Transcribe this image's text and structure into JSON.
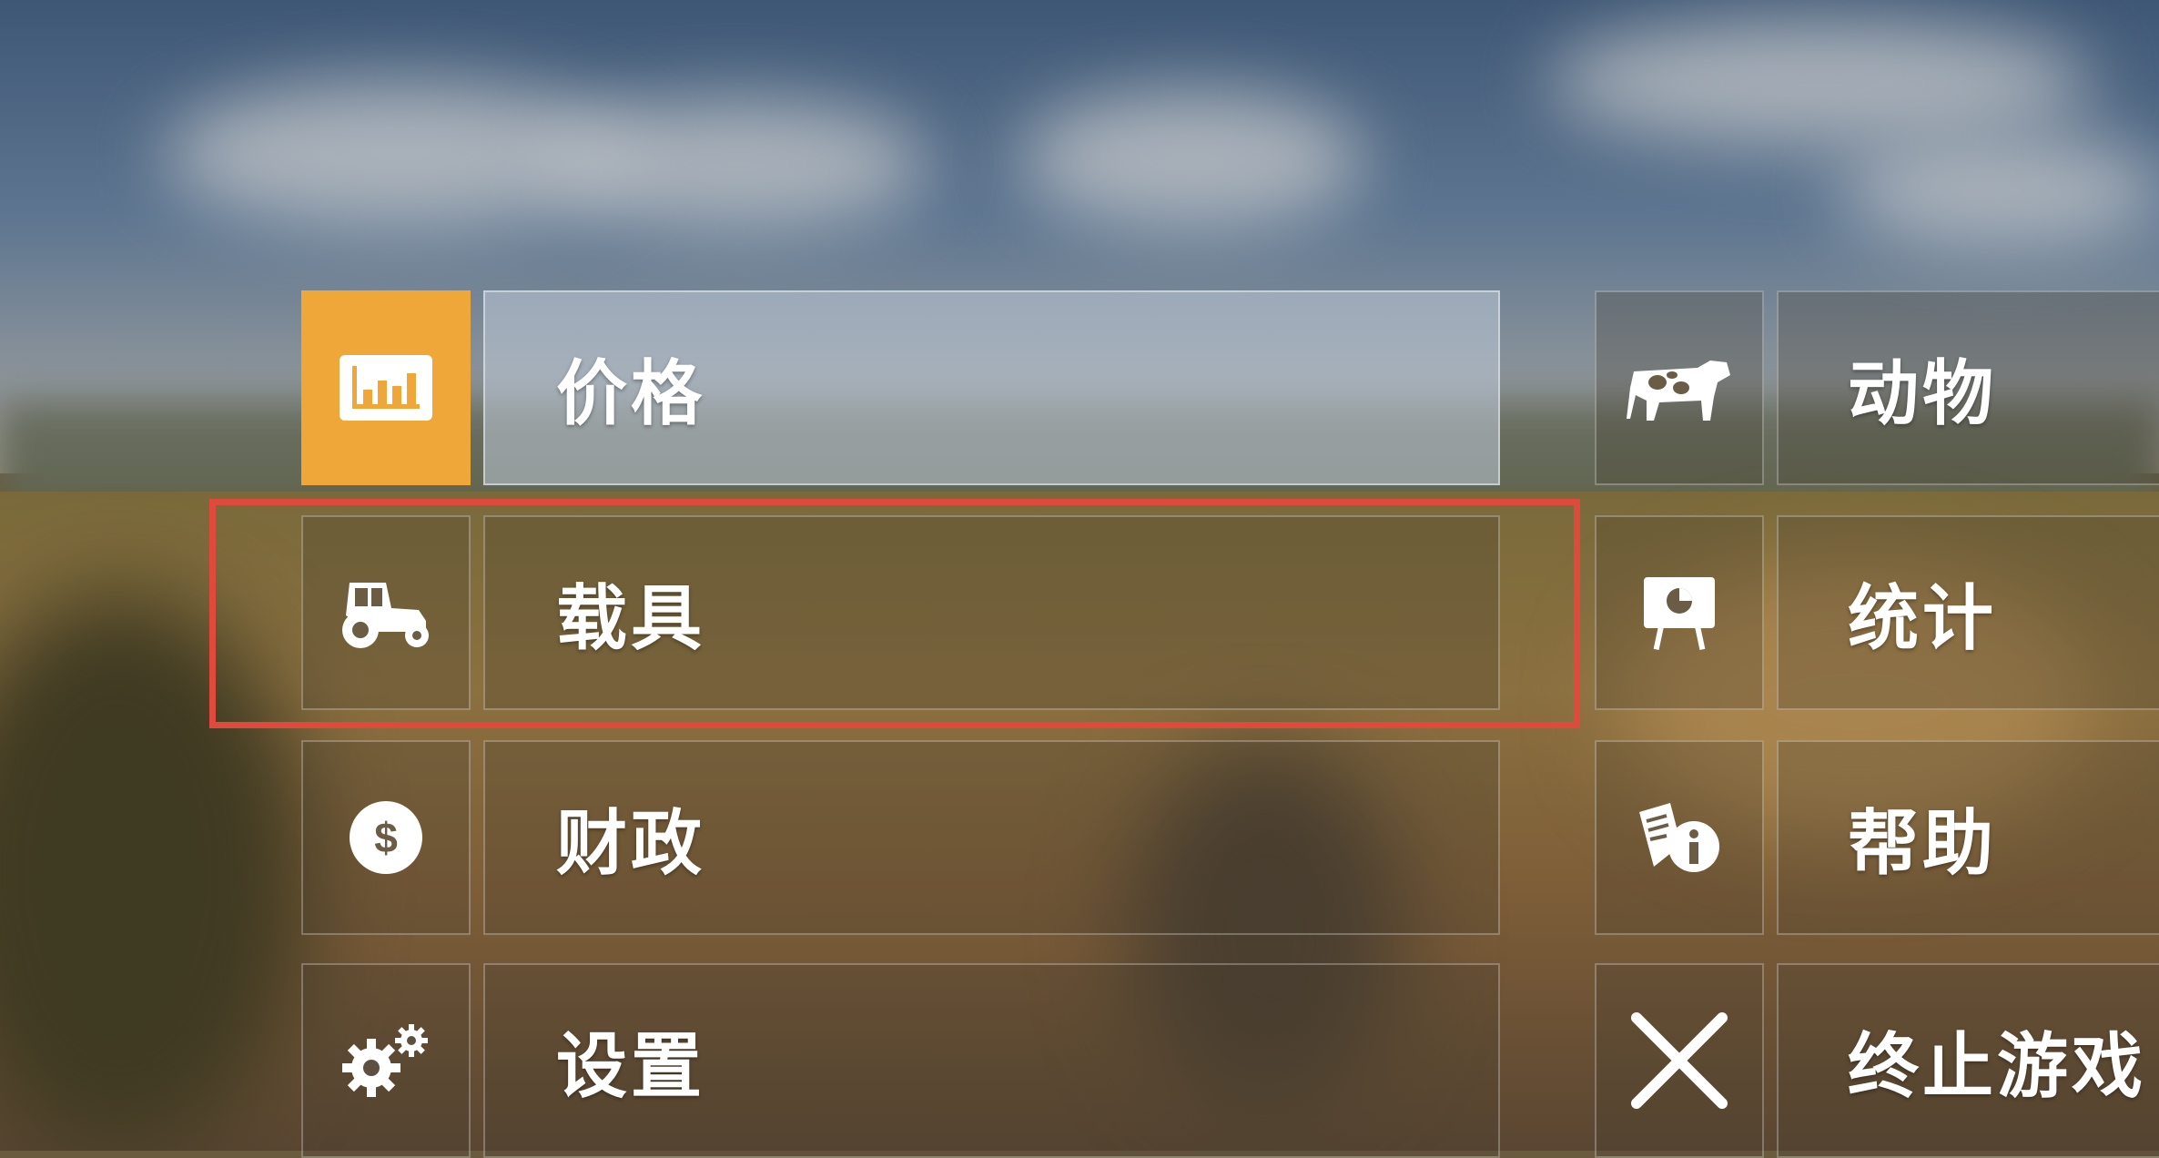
{
  "menu": {
    "left": [
      {
        "label": "价格",
        "icon": "price-chart-icon"
      },
      {
        "label": "载具",
        "icon": "tractor-icon"
      },
      {
        "label": "财政",
        "icon": "dollar-coin-icon"
      },
      {
        "label": "设置",
        "icon": "gears-icon"
      }
    ],
    "right": [
      {
        "label": "动物",
        "icon": "cow-icon"
      },
      {
        "label": "统计",
        "icon": "statistics-board-icon"
      },
      {
        "label": "帮助",
        "icon": "help-info-icon"
      },
      {
        "label": "终止游戏",
        "icon": "close-x-icon"
      }
    ],
    "selected": "价格",
    "highlighted": "载具"
  },
  "colors": {
    "accent": "#efa73a",
    "highlight_box": "#e04a3c",
    "text": "#ffffff"
  }
}
